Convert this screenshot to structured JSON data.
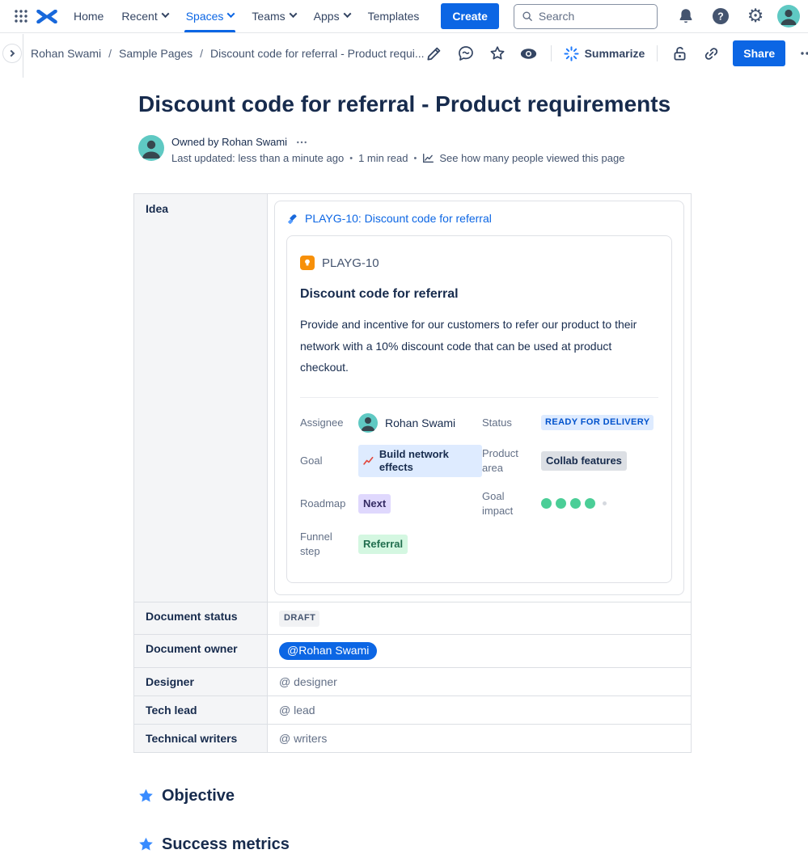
{
  "colors": {
    "accent": "#0C66E4",
    "nav_text": "#344563",
    "title_text": "#172B4D",
    "status_lozenge_bg": "#DEEBFF",
    "status_lozenge_text": "#0052CC",
    "gray_tag_bg": "#DCDFE4",
    "purple_tag_bg": "#DFD8FD",
    "green_tag_bg": "#D4F7E1",
    "goal_impact_dot": "#4BCE97",
    "section_star": "#388BFF",
    "idea_icon_bg": "#F79009"
  },
  "nav": {
    "items": [
      {
        "label": "Home"
      },
      {
        "label": "Recent"
      },
      {
        "label": "Spaces"
      },
      {
        "label": "Teams"
      },
      {
        "label": "Apps"
      },
      {
        "label": "Templates"
      }
    ],
    "create_label": "Create",
    "search_placeholder": "Search"
  },
  "breadcrumb": {
    "separator": "/",
    "items": [
      "Rohan Swami",
      "Sample Pages",
      "Discount code for referral - Product requi..."
    ]
  },
  "toolbar": {
    "summarize_label": "Summarize",
    "share_label": "Share"
  },
  "page": {
    "title": "Discount code for referral - Product requirements",
    "owned_by": "Owned by Rohan Swami",
    "last_updated": "Last updated: less than a minute ago",
    "read_time": "1 min read",
    "views_link": "See how many people viewed this page",
    "meta_separator": "•"
  },
  "idea_row_label": "Idea",
  "jira_card": {
    "link_text": "PLAYG-10: Discount code for referral",
    "issue_key": "PLAYG-10",
    "issue_title": "Discount code for referral",
    "issue_description": "Provide and incentive for our customers to refer our product to their network with a 10% discount code that can be used at product checkout.",
    "fields": {
      "assignee": {
        "label": "Assignee",
        "value": "Rohan Swami"
      },
      "status": {
        "label": "Status",
        "value": "READY FOR DELIVERY"
      },
      "goal": {
        "label": "Goal",
        "value": "Build network effects"
      },
      "product_area": {
        "label": "Product area",
        "value": "Collab features"
      },
      "roadmap": {
        "label": "Roadmap",
        "value": "Next"
      },
      "goal_impact": {
        "label": "Goal impact",
        "filled_dots": 4,
        "total_dots": 5
      },
      "funnel_step": {
        "label": "Funnel step",
        "value": "Referral"
      }
    }
  },
  "doc_table": {
    "rows": [
      {
        "label": "Document status",
        "value": "DRAFT",
        "type": "lozenge"
      },
      {
        "label": "Document owner",
        "value": "@Rohan Swami",
        "type": "mention"
      },
      {
        "label": "Designer",
        "value": "@ designer",
        "type": "placeholder"
      },
      {
        "label": "Tech lead",
        "value": "@ lead",
        "type": "placeholder"
      },
      {
        "label": "Technical writers",
        "value": "@ writers",
        "type": "placeholder"
      }
    ]
  },
  "sections": [
    {
      "title": "Objective"
    },
    {
      "title": "Success metrics"
    }
  ]
}
